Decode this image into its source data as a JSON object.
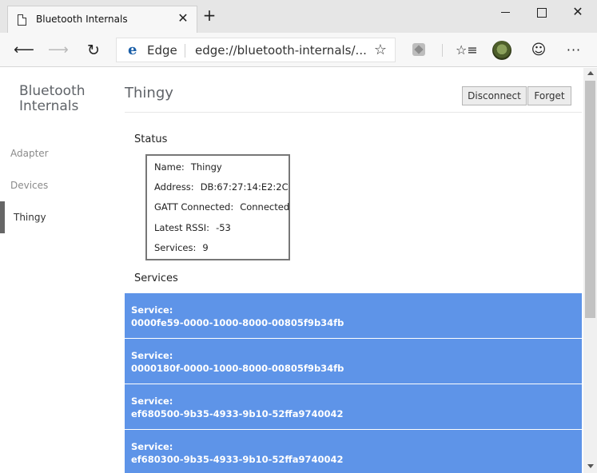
{
  "browser": {
    "tab_title": "Bluetooth Internals",
    "new_tab_symbol": "+",
    "address_brand": "Edge",
    "address_url": "edge://bluetooth-internals/...",
    "icons": {
      "tab": "page-icon",
      "back": "back-arrow-icon",
      "forward": "forward-arrow-icon",
      "refresh": "refresh-icon",
      "favorite": "star-icon",
      "extension": "extension-icon",
      "favorites": "favorites-icon",
      "profile": "avatar",
      "feedback": "smiley-icon",
      "more": "more-icon"
    }
  },
  "sidebar": {
    "title": "Bluetooth Internals",
    "items": [
      {
        "label": "Adapter",
        "active": false
      },
      {
        "label": "Devices",
        "active": false
      },
      {
        "label": "Thingy",
        "active": true
      }
    ]
  },
  "device": {
    "title": "Thingy",
    "disconnect_label": "Disconnect",
    "forget_label": "Forget"
  },
  "status": {
    "heading": "Status",
    "rows": [
      {
        "label": "Name:",
        "value": "Thingy"
      },
      {
        "label": "Address:",
        "value": "DB:67:27:14:E2:2C"
      },
      {
        "label": "GATT Connected:",
        "value": "Connected"
      },
      {
        "label": "Latest RSSI:",
        "value": "-53"
      },
      {
        "label": "Services:",
        "value": "9"
      }
    ]
  },
  "services": {
    "heading": "Services",
    "items": [
      {
        "label": "Service:",
        "uuid": "0000fe59-0000-1000-8000-00805f9b34fb"
      },
      {
        "label": "Service:",
        "uuid": "0000180f-0000-1000-8000-00805f9b34fb"
      },
      {
        "label": "Service:",
        "uuid": "ef680500-9b35-4933-9b10-52ffa9740042"
      },
      {
        "label": "Service:",
        "uuid": "ef680300-9b35-4933-9b10-52ffa9740042"
      }
    ]
  },
  "colors": {
    "service_bg": "#5e94e8",
    "active_indicator": "#666666"
  }
}
